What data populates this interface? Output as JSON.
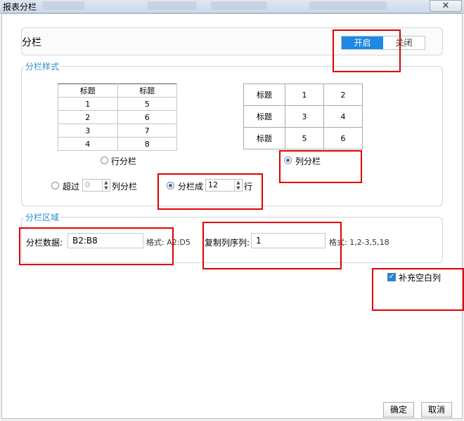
{
  "window": {
    "title": "报表分栏",
    "close_label": "✕"
  },
  "top_panel": {
    "label": "分栏",
    "toggle_on": "开启",
    "toggle_off": "关闭"
  },
  "style_section": {
    "legend": "分栏样式",
    "row_preview": {
      "headers": [
        "标题",
        "标题"
      ],
      "rows": [
        [
          "1",
          "5"
        ],
        [
          "2",
          "6"
        ],
        [
          "3",
          "7"
        ],
        [
          "4",
          "8"
        ]
      ]
    },
    "col_preview": {
      "rows": [
        [
          "标题",
          "1",
          "2"
        ],
        [
          "标题",
          "3",
          "4"
        ],
        [
          "标题",
          "5",
          "6"
        ]
      ]
    },
    "row_option_label": "行分栏",
    "col_option_label": "列分栏",
    "exceed_label": "超过",
    "exceed_value": "0",
    "exceed_suffix": "列分栏",
    "split_into_label": "分栏成",
    "split_into_value": "12",
    "split_into_suffix": "行"
  },
  "range_section": {
    "legend": "分栏区域",
    "data_label": "分栏数据:",
    "data_value": "B2:B8",
    "data_format": "格式: A2:D5",
    "copy_label": "复制列序列:",
    "copy_value": "1",
    "copy_format": "格式: 1,2-3,5,18"
  },
  "fill_blank_label": "补充空白列",
  "buttons": {
    "ok": "确定",
    "cancel": "取消"
  }
}
